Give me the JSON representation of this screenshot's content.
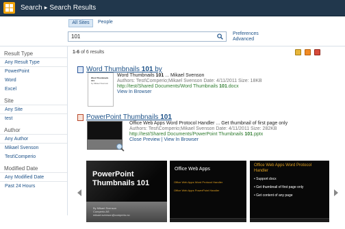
{
  "header": {
    "crumb_1": "Search",
    "crumb_2": "Search Results"
  },
  "scopes": {
    "active": "All Sites",
    "other": "People"
  },
  "search": {
    "value": "101",
    "preferences": "Preferences",
    "advanced": "Advanced"
  },
  "results_count": {
    "range": "1-6",
    "text": " of 6 results"
  },
  "refiners": [
    {
      "title": "Result Type",
      "items": [
        "Any Result Type",
        "PowerPoint",
        "Word",
        "Excel"
      ]
    },
    {
      "title": "Site",
      "items": [
        "Any Site",
        "test"
      ]
    },
    {
      "title": "Author",
      "items": [
        "Any Author",
        "Mikael Svenson",
        "Test\\Comperio"
      ]
    },
    {
      "title": "Modified Date",
      "items": [
        "Any Modified Date",
        "Past 24 Hours"
      ]
    }
  ],
  "result1": {
    "title_pre": "Word Thumbnails ",
    "title_hl": "101",
    "title_post": " by",
    "summary_pre": "Word Thumbnails ",
    "summary_hl": "101",
    "summary_post": " ... Mikael Svenson",
    "meta": "Authors: Test\\Comperio;Mikael Svenson   Date: 4/11/2011   Size: 18KB",
    "url_pre": "http://test/Shared Documents/Word Thumbnails ",
    "url_hl": "101",
    "url_post": ".docx",
    "link": "View In Browser",
    "thumb_title": "Word Thumbnails 101",
    "thumb_sub": "by Mikael Svenson"
  },
  "result2": {
    "title_pre": "PowerPoint Thumbnails ",
    "title_hl": "101",
    "summary": "Office Web Apps Word Protocol Handler ... Get thumbnail of first page only",
    "meta": "Authors: Test\\Comperio;Mikael Svenson   Date: 4/11/2011   Size: 282KB",
    "url_pre": "http://test/Shared Documents/PowerPoint Thumbnails ",
    "url_hl": "101",
    "url_post": ".pptx",
    "link_1": "Close Preview",
    "link_sep": " | ",
    "link_2": "View In Browser"
  },
  "slides": {
    "s1_line1": "PowerPoint",
    "s1_line2": "Thumbnails ",
    "s1_num": "101",
    "s1_sub1": "By Mikael Svenson",
    "s1_sub2": "Comperio AS",
    "s1_sub3": "mikael.svenson@comperio.no",
    "s2_title": "Office Web Apps",
    "s2_b1": "Office Web Apps Word Protocol Handler",
    "s2_b2": "Office Web Apps PowerPoint Handler",
    "s3_title1": "Office Web Apps Word Protocol",
    "s3_title2": "Handler",
    "s3_b1": "• Support docx",
    "s3_b2": "• Get thumbnail of first page only",
    "s3_b3": "• Get content of any page"
  }
}
